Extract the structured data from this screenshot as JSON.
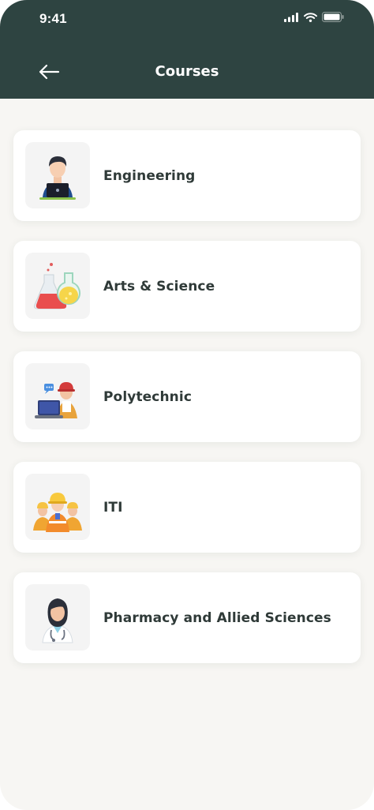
{
  "status_bar": {
    "time": "9:41"
  },
  "header": {
    "title": "Courses"
  },
  "courses": [
    {
      "label": "Engineering",
      "icon": "engineer-laptop-icon"
    },
    {
      "label": "Arts & Science",
      "icon": "flasks-icon"
    },
    {
      "label": "Polytechnic",
      "icon": "worker-laptop-icon"
    },
    {
      "label": "ITI",
      "icon": "workers-helmets-icon"
    },
    {
      "label": "Pharmacy and Allied Sciences",
      "icon": "doctor-icon"
    }
  ],
  "colors": {
    "header_bg": "#2e4441",
    "page_bg": "#f7f6f3",
    "card_bg": "#ffffff",
    "text": "#2f3a38"
  }
}
